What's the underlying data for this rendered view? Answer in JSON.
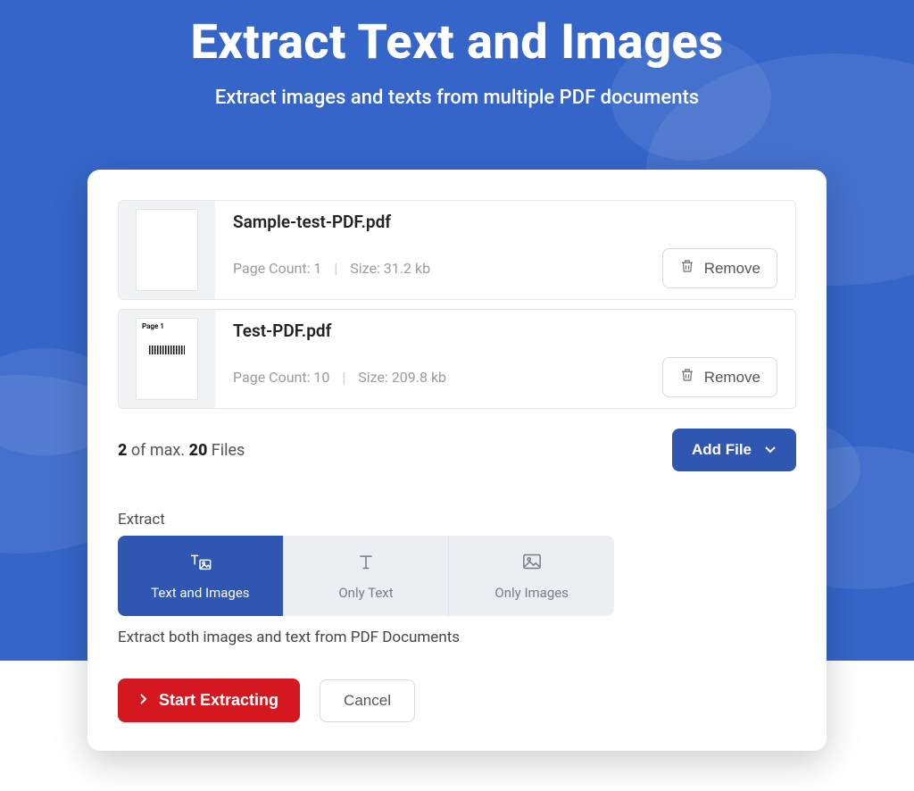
{
  "header": {
    "title": "Extract Text and Images",
    "subtitle": "Extract images and texts from multiple PDF documents"
  },
  "files": [
    {
      "name": "Sample-test-PDF.pdf",
      "page_count_label": "Page Count: 1",
      "size_label": "Size: 31.2 kb",
      "remove_label": "Remove",
      "thumb_page_label": ""
    },
    {
      "name": "Test-PDF.pdf",
      "page_count_label": "Page Count: 10",
      "size_label": "Size: 209.8 kb",
      "remove_label": "Remove",
      "thumb_page_label": "Page 1"
    }
  ],
  "status": {
    "count": "2",
    "mid": " of max. ",
    "max": "20",
    "suffix": " Files",
    "add_file_label": "Add File"
  },
  "extract": {
    "section_label": "Extract",
    "options": [
      {
        "label": "Text and Images"
      },
      {
        "label": "Only Text"
      },
      {
        "label": "Only Images"
      }
    ],
    "description": "Extract both images and text from PDF Documents"
  },
  "actions": {
    "start_label": "Start Extracting",
    "cancel_label": "Cancel"
  }
}
